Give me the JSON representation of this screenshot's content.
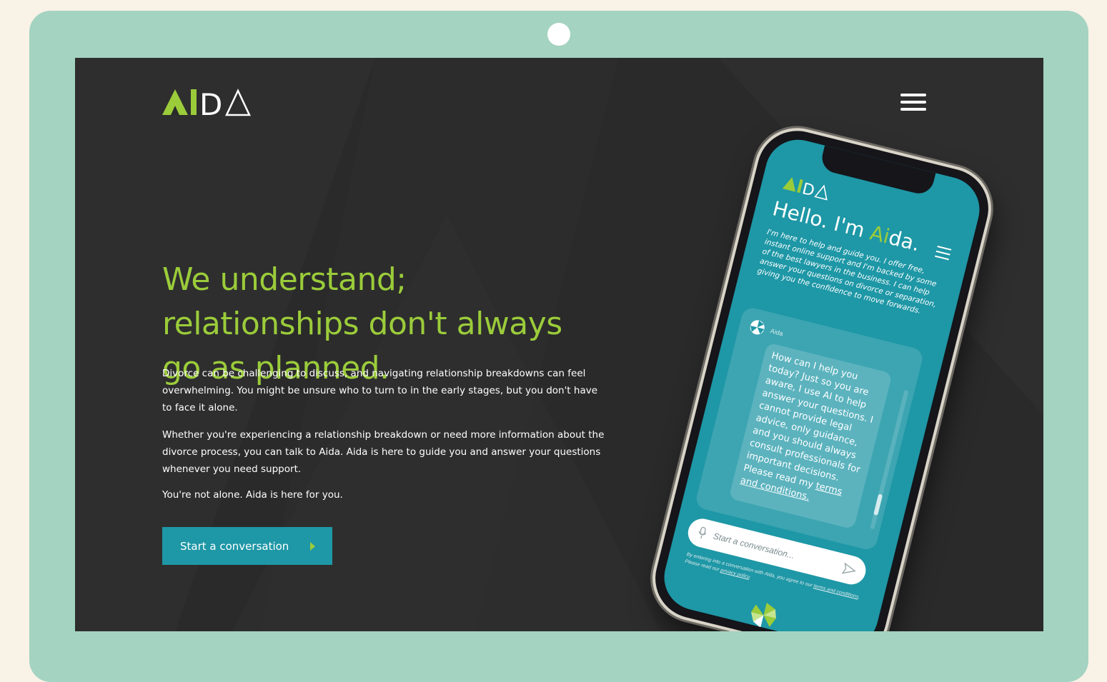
{
  "brand": {
    "logo_left": "AI",
    "logo_right": "D",
    "colors": {
      "green": "#9bcc3a",
      "teal": "#1e97a6",
      "dark": "#2a2a2a",
      "frame": "#a4d3c1"
    }
  },
  "header": {
    "menu_icon": "hamburger-icon"
  },
  "hero": {
    "headline": "We understand; relationships don't always go as planned.",
    "para1": "Divorce can be challenging to discuss, and navigating relationship breakdowns can feel overwhelming. You might be unsure who to turn to in the early stages, but you don't have to face it alone.",
    "para2": "Whether you're experiencing a relationship breakdown or need more information about the divorce process, you can talk to Aida. Aida is here to guide you and answer your questions whenever you need support.",
    "para3": "You're not alone. Aida is here for you.",
    "cta_label": "Start a conversation"
  },
  "phone": {
    "hello_prefix": "Hello. I'm ",
    "hello_ai": "Ai",
    "hello_suffix": "da.",
    "intro": "I'm here to help and guide you. I offer free, instant online support and I'm backed by some of the best lawyers in the business. I can help answer your questions on divorce or separation, giving you the confidence to move forwards.",
    "chat_name": "Aida",
    "bubble_text": "How can I help you today? Just so you are aware, I use AI to help answer your questions. I cannot provide legal advice, only guidance, and you should always consult professionals for important decisions. Please read my ",
    "bubble_link": "terms and conditions.",
    "input_placeholder": "Start a conversation...",
    "disclaimer_pre": "By entering into a conversation with Aida, you agree to our ",
    "disclaimer_terms": "terms and conditions",
    "disclaimer_mid": ". Please read our ",
    "disclaimer_privacy": "privacy policy",
    "disclaimer_end": "."
  }
}
